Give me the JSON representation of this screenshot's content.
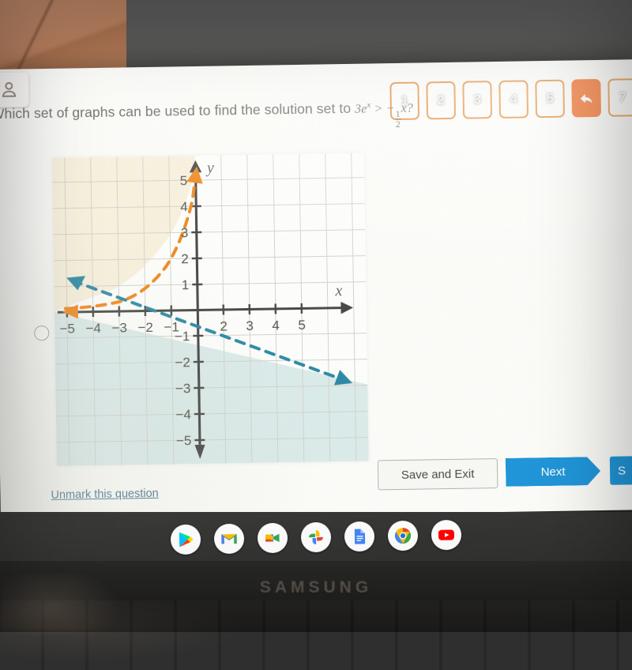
{
  "toolbar": {
    "profile_icon": "user-icon",
    "question_numbers": [
      "1",
      "2",
      "3",
      "4",
      "5"
    ],
    "flag_icon": "back-arrow-icon",
    "question_number_after_flag": "7"
  },
  "question": {
    "text_before": "Which set of graphs can be used to find the solution set to ",
    "expr_coefficient": "3",
    "expr_base": "e",
    "expr_exponent": "x",
    "expr_relation": ">",
    "expr_minus": "−",
    "frac_numerator": "1",
    "frac_denominator": "2",
    "expr_tail": "x?"
  },
  "option": {
    "id": "a",
    "selected": false
  },
  "chart_data": {
    "type": "line",
    "title": "",
    "xlabel": "x",
    "ylabel": "y",
    "xlim": [
      -5.8,
      5.8
    ],
    "ylim": [
      -5.8,
      5.8
    ],
    "grid": true,
    "x_ticks": [
      -5,
      -4,
      -3,
      -2,
      -1,
      2,
      3,
      4,
      5
    ],
    "x_tick_labels": [
      "−5",
      "−4",
      "−3",
      "−2",
      "−1",
      "2",
      "3",
      "4",
      "5"
    ],
    "y_ticks": [
      5,
      4,
      3,
      2,
      1,
      -1,
      -2,
      -3,
      -4,
      -5
    ],
    "y_tick_labels": [
      "5",
      "4",
      "3",
      "2",
      "1",
      "−1",
      "−2",
      "−3",
      "−4",
      "−5"
    ],
    "series": [
      {
        "name": "y = 3e^x",
        "equation": "y = 3e^x",
        "color": "#ef8a22",
        "style": "dashed",
        "arrow_ends": "both",
        "y_intercept": 3,
        "shaded_region": "above",
        "shade_color": "#f7f0dc"
      },
      {
        "name": "y = -1/2 x",
        "equation": "y = −1/2 x",
        "color": "#2f8ba5",
        "style": "dashed",
        "arrow_ends": "both",
        "slope": -0.5,
        "y_intercept": 0,
        "shaded_region": "below",
        "shade_color": "#d5e7e5"
      }
    ],
    "axis_color": "#4a4a48",
    "grid_color": "#d3d3cd",
    "cursor": "pointing-hand-cursor"
  },
  "footer": {
    "save_label": "Save and Exit",
    "next_label": "Next",
    "submit_label": "S",
    "unmark_label": "Unmark this question"
  },
  "shelf": {
    "apps": [
      {
        "name": "play-store-icon",
        "label": "Play Store"
      },
      {
        "name": "gmail-icon",
        "label": "Gmail"
      },
      {
        "name": "google-meet-icon",
        "label": "Meet"
      },
      {
        "name": "google-photos-icon",
        "label": "Photos"
      },
      {
        "name": "google-docs-icon",
        "label": "Docs"
      },
      {
        "name": "chrome-icon",
        "label": "Chrome"
      },
      {
        "name": "youtube-icon",
        "label": "YouTube"
      }
    ]
  },
  "device": {
    "brand": "SAMSUNG"
  }
}
